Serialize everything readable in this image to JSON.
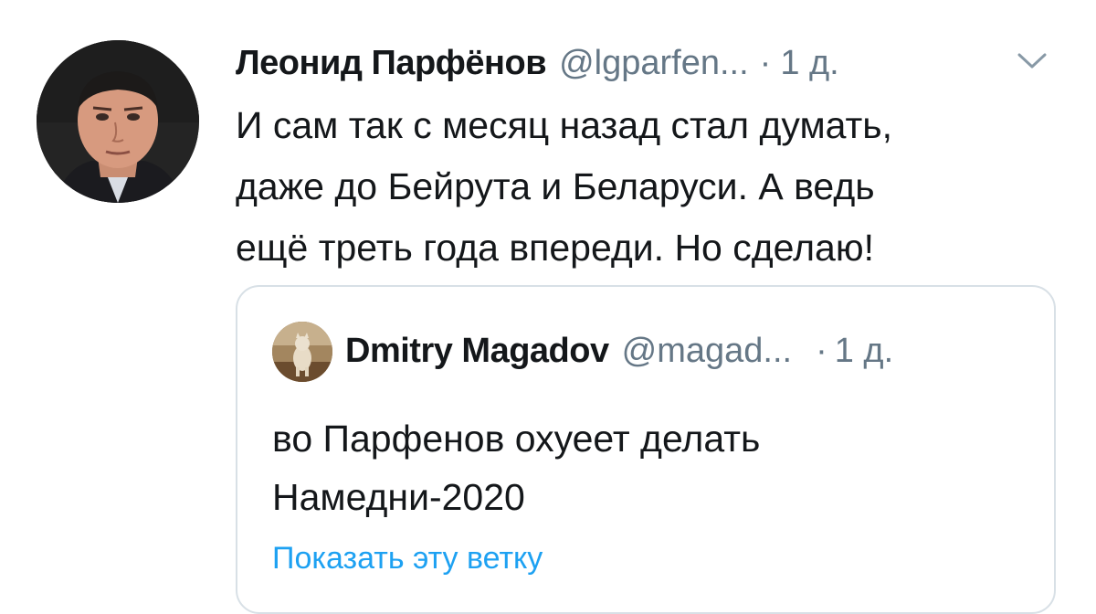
{
  "tweet": {
    "author_name": "Леонид Парфёнов",
    "author_handle": "@lgparfen...",
    "dot": "·",
    "time": "1 д.",
    "text_lines": [
      "И сам так с месяц назад стал думать,",
      "даже до Бейрута и Беларуси. А ведь",
      "ещё треть года впереди. Но сделаю!"
    ],
    "menu_icon": "chevron-down-icon"
  },
  "quoted_tweet": {
    "author_name": "Dmitry Magadov",
    "author_handle": "@magad...",
    "dot": "·",
    "time": "1 д.",
    "text_lines": [
      "во Парфенов охуеет делать",
      "Намедни-2020"
    ],
    "show_thread_label": "Показать эту ветку"
  },
  "colors": {
    "text": "#14171a",
    "secondary": "#657786",
    "link": "#1da1f2",
    "border": "#d8e0e6"
  }
}
